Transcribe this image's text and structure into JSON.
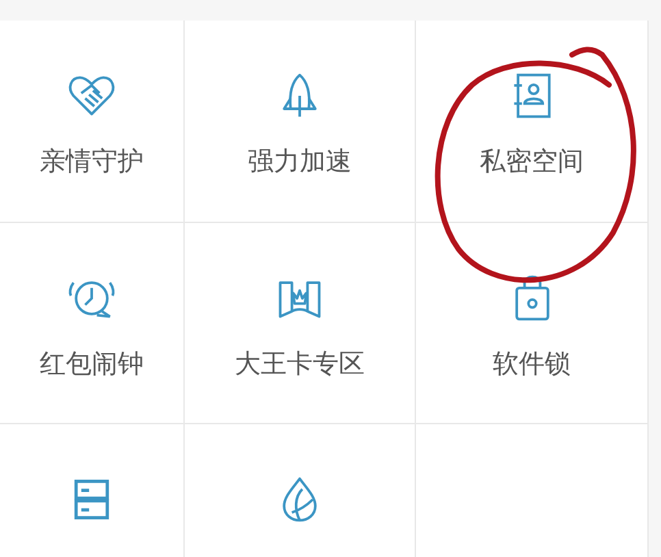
{
  "grid": [
    {
      "kind": "tool",
      "label": "亲情守护"
    },
    {
      "kind": "tool",
      "label": "强力加速"
    },
    {
      "kind": "tool",
      "label": "私密空间"
    },
    {
      "kind": "tool",
      "label": "红包闹钟"
    },
    {
      "kind": "tool",
      "label": "大王卡专区"
    },
    {
      "kind": "tool",
      "label": "软件锁"
    },
    {
      "kind": "tool"
    },
    {
      "kind": "tool"
    },
    {
      "kind": "empty"
    }
  ]
}
